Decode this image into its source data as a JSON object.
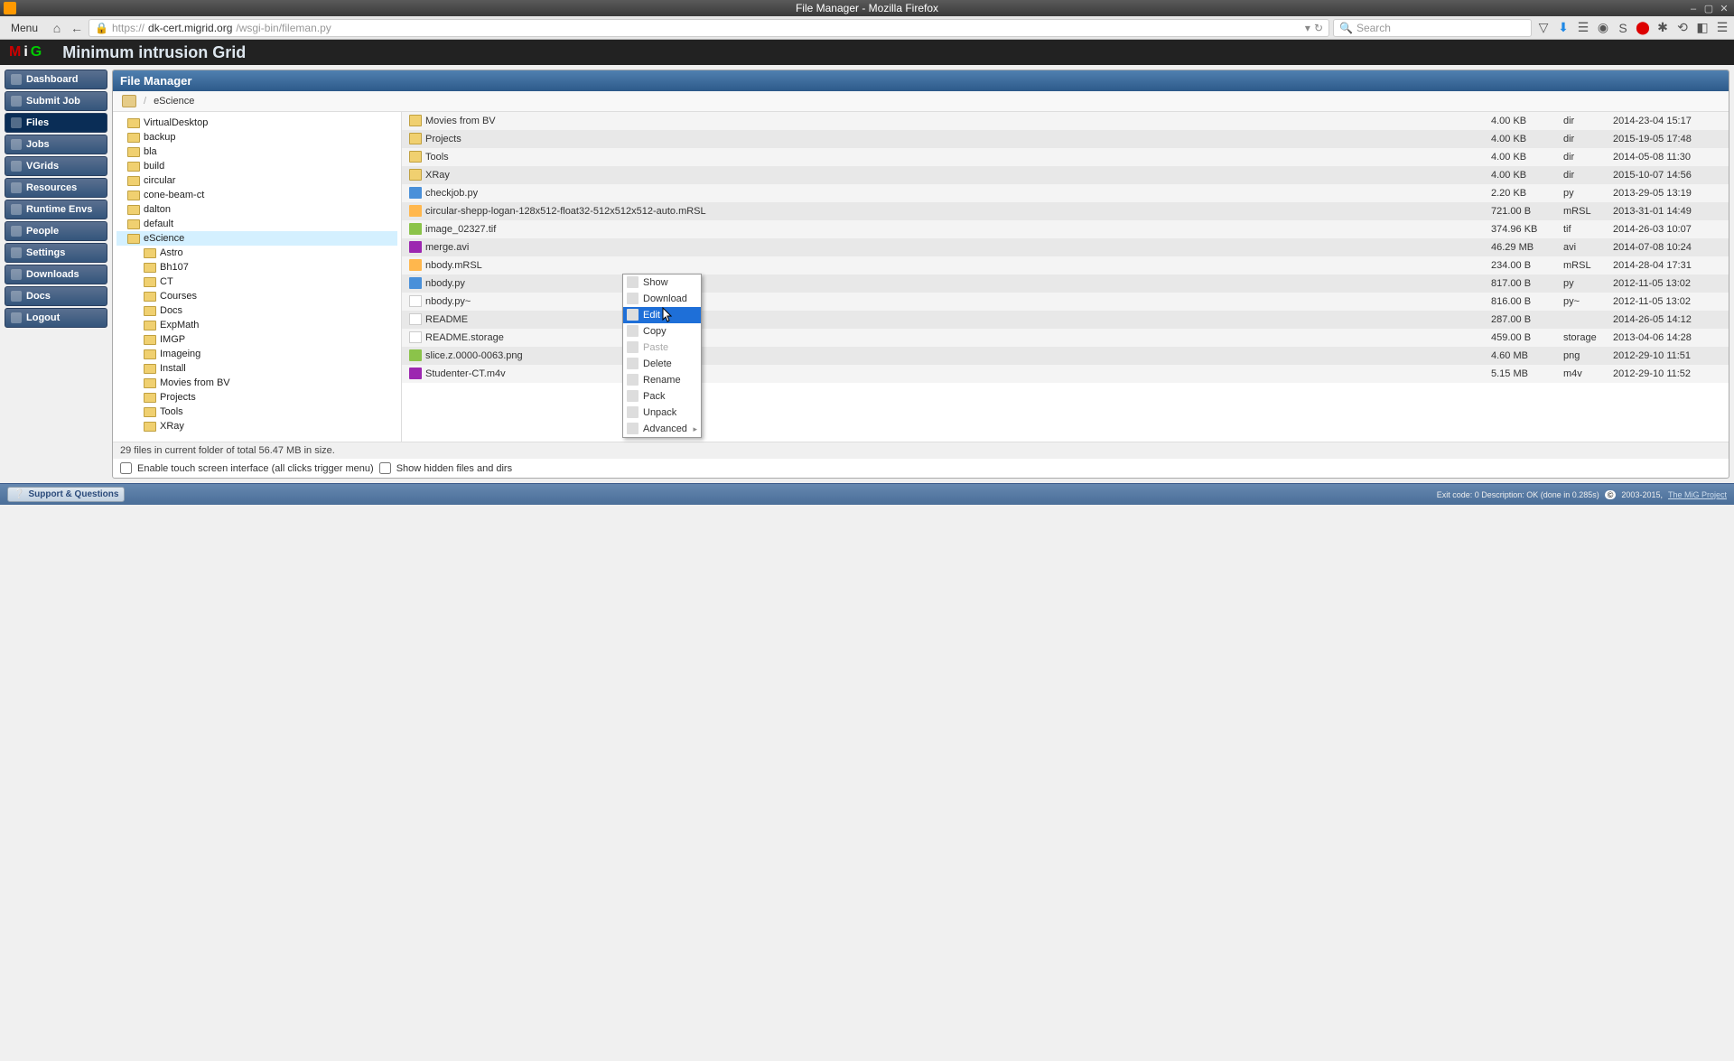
{
  "window": {
    "title": "File Manager - Mozilla Firefox"
  },
  "browser": {
    "menu": "Menu",
    "url_prefix": "https://",
    "url_domain": "dk-cert.migrid.org",
    "url_path": "/wsgi-bin/fileman.py",
    "search_placeholder": "Search"
  },
  "header": {
    "site_title": "Minimum intrusion Grid"
  },
  "sidenav": [
    {
      "label": "Dashboard",
      "active": false
    },
    {
      "label": "Submit Job",
      "active": false
    },
    {
      "label": "Files",
      "active": true
    },
    {
      "label": "Jobs",
      "active": false
    },
    {
      "label": "VGrids",
      "active": false
    },
    {
      "label": "Resources",
      "active": false
    },
    {
      "label": "Runtime Envs",
      "active": false
    },
    {
      "label": "People",
      "active": false
    },
    {
      "label": "Settings",
      "active": false
    },
    {
      "label": "Downloads",
      "active": false
    },
    {
      "label": "Docs",
      "active": false
    },
    {
      "label": "Logout",
      "active": false
    }
  ],
  "panel": {
    "title": "File Manager"
  },
  "breadcrumb": {
    "separator": "/",
    "path": "eScience"
  },
  "tree": [
    {
      "label": "VirtualDesktop",
      "indent": false
    },
    {
      "label": "backup",
      "indent": false
    },
    {
      "label": "bla",
      "indent": false
    },
    {
      "label": "build",
      "indent": false
    },
    {
      "label": "circular",
      "indent": false
    },
    {
      "label": "cone-beam-ct",
      "indent": false
    },
    {
      "label": "dalton",
      "indent": false
    },
    {
      "label": "default",
      "indent": false
    },
    {
      "label": "eScience",
      "indent": false,
      "selected": true
    },
    {
      "label": "Astro",
      "indent": true
    },
    {
      "label": "Bh107",
      "indent": true
    },
    {
      "label": "CT",
      "indent": true
    },
    {
      "label": "Courses",
      "indent": true
    },
    {
      "label": "Docs",
      "indent": true
    },
    {
      "label": "ExpMath",
      "indent": true
    },
    {
      "label": "IMGP",
      "indent": true
    },
    {
      "label": "Imageing",
      "indent": true
    },
    {
      "label": "Install",
      "indent": true
    },
    {
      "label": "Movies from BV",
      "indent": true
    },
    {
      "label": "Projects",
      "indent": true
    },
    {
      "label": "Tools",
      "indent": true
    },
    {
      "label": "XRay",
      "indent": true
    }
  ],
  "files": [
    {
      "name": "Movies from BV",
      "size": "4.00 KB",
      "ext": "dir",
      "date": "2014-23-04 15:17",
      "ic": "ic-folder"
    },
    {
      "name": "Projects",
      "size": "4.00 KB",
      "ext": "dir",
      "date": "2015-19-05 17:48",
      "ic": "ic-folder"
    },
    {
      "name": "Tools",
      "size": "4.00 KB",
      "ext": "dir",
      "date": "2014-05-08 11:30",
      "ic": "ic-folder"
    },
    {
      "name": "XRay",
      "size": "4.00 KB",
      "ext": "dir",
      "date": "2015-10-07 14:56",
      "ic": "ic-folder"
    },
    {
      "name": "checkjob.py",
      "size": "2.20 KB",
      "ext": "py",
      "date": "2013-29-05 13:19",
      "ic": "ic-py"
    },
    {
      "name": "circular-shepp-logan-128x512-float32-512x512x512-auto.mRSL",
      "size": "721.00 B",
      "ext": "mRSL",
      "date": "2013-31-01 14:49",
      "ic": "ic-mrsl"
    },
    {
      "name": "image_02327.tif",
      "size": "374.96 KB",
      "ext": "tif",
      "date": "2014-26-03 10:07",
      "ic": "ic-img"
    },
    {
      "name": "merge.avi",
      "size": "46.29 MB",
      "ext": "avi",
      "date": "2014-07-08 10:24",
      "ic": "ic-vid"
    },
    {
      "name": "nbody.mRSL",
      "size": "234.00 B",
      "ext": "mRSL",
      "date": "2014-28-04 17:31",
      "ic": "ic-mrsl"
    },
    {
      "name": "nbody.py",
      "size": "817.00 B",
      "ext": "py",
      "date": "2012-11-05 13:02",
      "ic": "ic-py"
    },
    {
      "name": "nbody.py~",
      "size": "816.00 B",
      "ext": "py~",
      "date": "2012-11-05 13:02",
      "ic": "ic-doc"
    },
    {
      "name": "README",
      "size": "287.00 B",
      "ext": "",
      "date": "2014-26-05 14:12",
      "ic": "ic-doc"
    },
    {
      "name": "README.storage",
      "size": "459.00 B",
      "ext": "storage",
      "date": "2013-04-06 14:28",
      "ic": "ic-doc"
    },
    {
      "name": "slice.z.0000-0063.png",
      "size": "4.60 MB",
      "ext": "png",
      "date": "2012-29-10 11:51",
      "ic": "ic-img"
    },
    {
      "name": "Studenter-CT.m4v",
      "size": "5.15 MB",
      "ext": "m4v",
      "date": "2012-29-10 11:52",
      "ic": "ic-vid"
    }
  ],
  "context_menu": [
    {
      "label": "Show",
      "hl": false
    },
    {
      "label": "Download",
      "hl": false
    },
    {
      "label": "Edit",
      "hl": true
    },
    {
      "label": "Copy",
      "hl": false
    },
    {
      "label": "Paste",
      "hl": false,
      "disabled": true
    },
    {
      "label": "Delete",
      "hl": false
    },
    {
      "label": "Rename",
      "hl": false
    },
    {
      "label": "Pack",
      "hl": false
    },
    {
      "label": "Unpack",
      "hl": false
    },
    {
      "label": "Advanced",
      "hl": false,
      "submenu": true
    }
  ],
  "status": "29 files in current folder of total 56.47 MB in size.",
  "options": {
    "touch": "Enable touch screen interface (all clicks trigger menu)",
    "hidden": "Show hidden files and dirs"
  },
  "footer": {
    "support": "Support & Questions",
    "exit": "Exit code: 0 Description: OK (done in 0.285s)",
    "copyright": "2003-2015,",
    "link": "The MiG Project"
  }
}
